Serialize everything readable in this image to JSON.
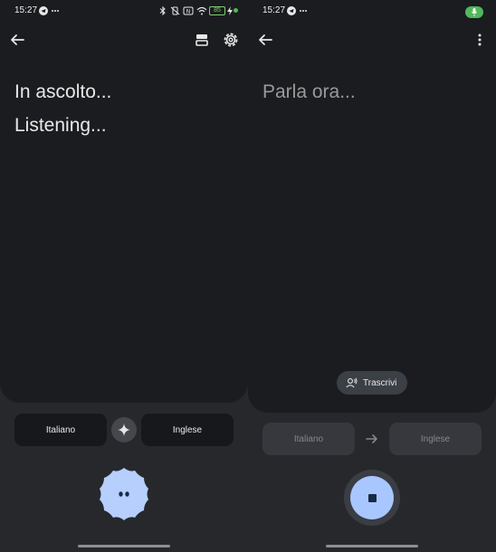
{
  "left": {
    "status_time": "15:27",
    "battery_level": "85",
    "heading_lines": [
      "In ascolto...",
      "Listening..."
    ],
    "source_lang": "Italiano",
    "target_lang": "Inglese",
    "icons": {
      "back": "arrow-left-icon",
      "layout": "split-screen-icon",
      "settings": "gear-icon",
      "swap": "sparkle-icon",
      "mic": "scalloped-mic-icon"
    }
  },
  "right": {
    "status_time": "15:27",
    "heading": "Parla ora...",
    "transcribe_chip": "Trascrivi",
    "source_lang": "Italiano",
    "target_lang": "Inglese",
    "icons": {
      "back": "arrow-left-icon",
      "menu": "more-vert-icon",
      "chip": "voice-person-icon",
      "arrow": "arrow-right-icon",
      "stop": "stop-icon",
      "mic_indicator": "mic-in-use-icon"
    }
  },
  "colors": {
    "background": "#26282c",
    "card": "#1b1c1f",
    "accent": "#a9c7ff",
    "mic_indicator": "#51b85a"
  }
}
